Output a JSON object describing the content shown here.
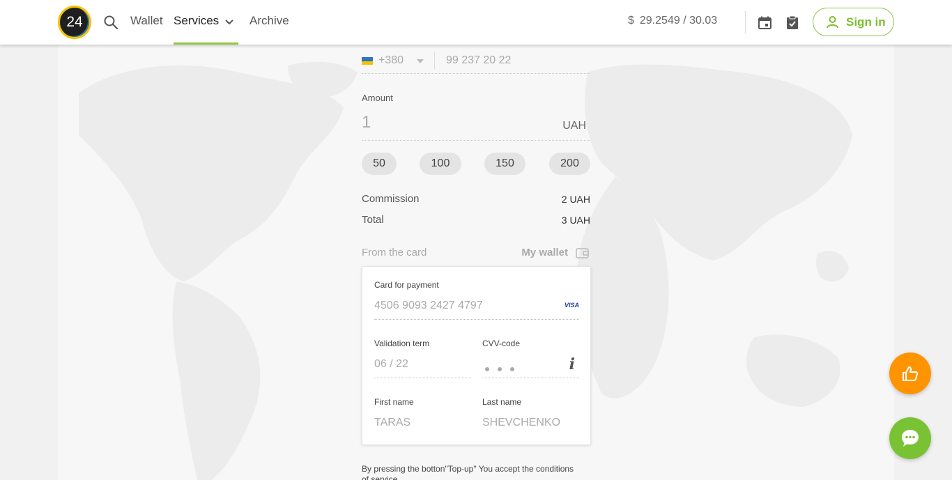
{
  "header": {
    "logo_text": "24",
    "nav": {
      "wallet": "Wallet",
      "services": "Services",
      "archive": "Archive"
    },
    "rate": {
      "currency_symbol": "$",
      "value": "29.2549 / 30.03"
    },
    "sign_in_label": "Sign in",
    "accent_color": "#8dc63f"
  },
  "form": {
    "phone": {
      "country_code": "+380",
      "placeholder": "99 237 20 22"
    },
    "amount": {
      "label": "Amount",
      "value": "1",
      "currency": "UAH"
    },
    "quick_amounts": [
      "50",
      "100",
      "150",
      "200"
    ],
    "commission": {
      "label": "Commission",
      "value": "2 UAH"
    },
    "total": {
      "label": "Total",
      "value": "3 UAH"
    },
    "source": {
      "from_card": "From the card",
      "my_wallet": "My wallet"
    },
    "card": {
      "number_label": "Card for payment",
      "number_placeholder": "4506 9093 2427 4797",
      "brand": "VISA",
      "validity_label": "Validation term",
      "validity_placeholder": "06 / 22",
      "cvv_label": "CVV-code",
      "cvv_info": "i",
      "first_name_label": "First name",
      "first_name_placeholder": "TARAS",
      "last_name_label": "Last name",
      "last_name_placeholder": "SHEVCHENKO"
    },
    "terms_text": "By pressing the botton\"Top-up\" You accept the conditions",
    "terms_text_2": "of service"
  },
  "fabs": {
    "like_color": "#ff9300",
    "chat_color": "#79c233"
  }
}
